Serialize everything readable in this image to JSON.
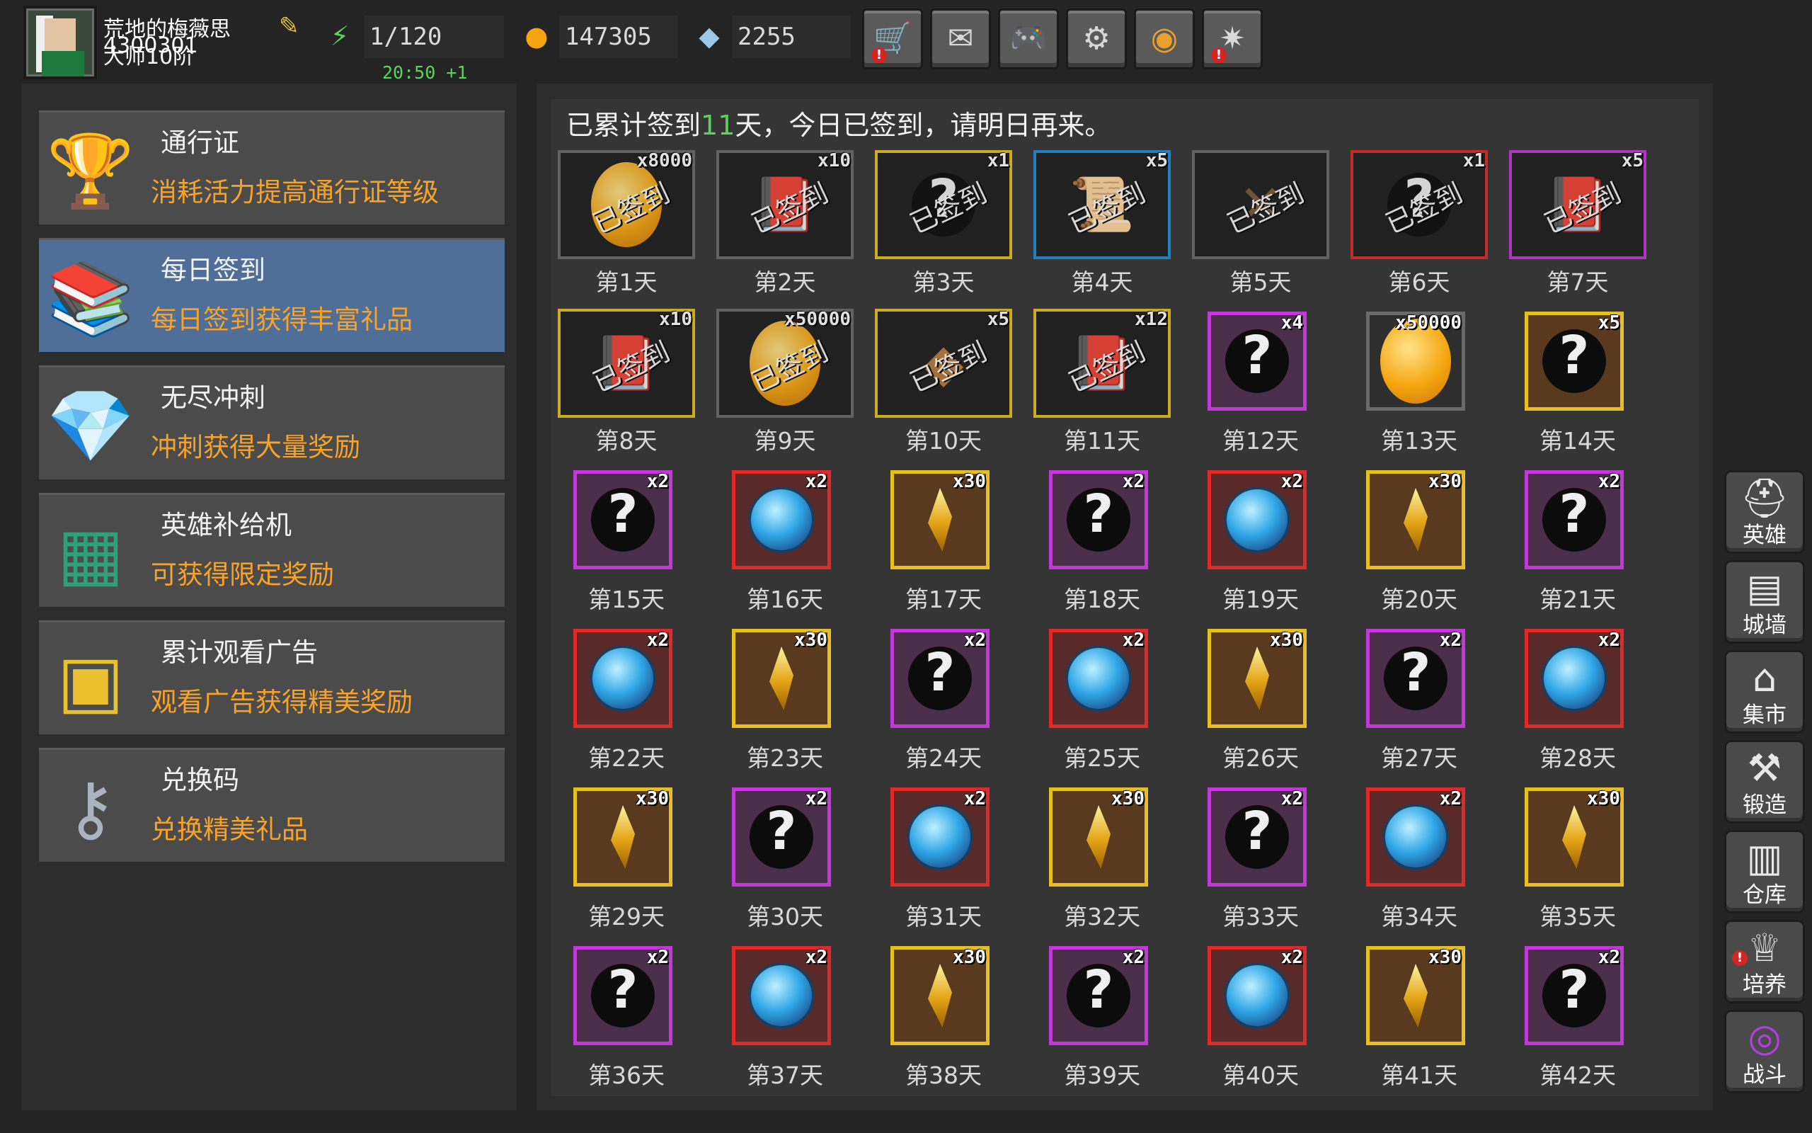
{
  "player": {
    "name": "荒地的梅薇思",
    "id": "4300301",
    "rank": "大师10阶",
    "icons": {
      "avatar": "mage-avatar",
      "edit": "edit-icon"
    }
  },
  "resources": {
    "energy": {
      "value": "1/120",
      "icon": "lightning-plus-icon"
    },
    "timer": "20:50 +1",
    "gold": {
      "value": "147305",
      "icon": "gold-coin-plus-icon"
    },
    "gems": {
      "value": "2255",
      "icon": "diamond-plus-icon"
    }
  },
  "top_buttons": [
    {
      "name": "shop-cart-icon",
      "alert": true
    },
    {
      "name": "mail-icon",
      "alert": false
    },
    {
      "name": "gamepad-icon",
      "alert": false
    },
    {
      "name": "gear-icon",
      "alert": false
    },
    {
      "name": "color-wheel-icon",
      "alert": false
    },
    {
      "name": "fireworks-icon",
      "alert": true
    }
  ],
  "menu": [
    {
      "title": "通行证",
      "desc": "消耗活力提高通行证等级",
      "icon": "golden-chalice-icon",
      "active": false
    },
    {
      "title": "每日签到",
      "desc": "每日签到获得丰富礼品",
      "icon": "book-stack-icon",
      "active": true
    },
    {
      "title": "无尽冲刺",
      "desc": "冲刺获得大量奖励",
      "icon": "crystal-trophy-icon",
      "active": false
    },
    {
      "title": "英雄补给机",
      "desc": "可获得限定奖励",
      "icon": "supply-machine-icon",
      "active": false
    },
    {
      "title": "累计观看广告",
      "desc": "观看广告获得精美奖励",
      "icon": "treasure-chest-icon",
      "active": false
    },
    {
      "title": "兑换码",
      "desc": "兑换精美礼品",
      "icon": "key-icon",
      "active": false
    }
  ],
  "signin": {
    "prefix": "已累计签到",
    "days": "11",
    "suffix": "天，今日已签到，请明日再来。",
    "claimed_label": "已签到"
  },
  "rewards": [
    {
      "day": "第1天",
      "qty": "x8000",
      "item": "coin",
      "rarity": "gray",
      "claimed": true
    },
    {
      "day": "第2天",
      "qty": "x10",
      "item": "book",
      "rarity": "gray",
      "claimed": true
    },
    {
      "day": "第3天",
      "qty": "x1",
      "item": "mystery",
      "rarity": "gold",
      "claimed": true
    },
    {
      "day": "第4天",
      "qty": "x5",
      "item": "scroll",
      "rarity": "blue",
      "claimed": true
    },
    {
      "day": "第5天",
      "qty": "",
      "item": "crossbow",
      "rarity": "gray",
      "claimed": true
    },
    {
      "day": "第6天",
      "qty": "x1",
      "item": "mystery",
      "rarity": "red",
      "claimed": true
    },
    {
      "day": "第7天",
      "qty": "x5",
      "item": "book",
      "rarity": "purple",
      "claimed": true
    },
    {
      "day": "第8天",
      "qty": "x10",
      "item": "book",
      "rarity": "gold",
      "claimed": true
    },
    {
      "day": "第9天",
      "qty": "x50000",
      "item": "coin",
      "rarity": "gray",
      "claimed": true
    },
    {
      "day": "第10天",
      "qty": "x5",
      "item": "ore",
      "rarity": "gold",
      "claimed": true
    },
    {
      "day": "第11天",
      "qty": "x12",
      "item": "book",
      "rarity": "gold",
      "claimed": true
    },
    {
      "day": "第12天",
      "qty": "x4",
      "item": "mystery",
      "rarity": "purple",
      "claimed": false
    },
    {
      "day": "第13天",
      "qty": "x50000",
      "item": "coin",
      "rarity": "gray",
      "claimed": false
    },
    {
      "day": "第14天",
      "qty": "x5",
      "item": "mystery",
      "rarity": "gold",
      "claimed": false
    },
    {
      "day": "第15天",
      "qty": "x2",
      "item": "mystery",
      "rarity": "purple",
      "claimed": false
    },
    {
      "day": "第16天",
      "qty": "x2",
      "item": "orb",
      "rarity": "red",
      "claimed": false
    },
    {
      "day": "第17天",
      "qty": "x30",
      "item": "crystal",
      "rarity": "gold",
      "claimed": false
    },
    {
      "day": "第18天",
      "qty": "x2",
      "item": "mystery",
      "rarity": "purple",
      "claimed": false
    },
    {
      "day": "第19天",
      "qty": "x2",
      "item": "orb",
      "rarity": "red",
      "claimed": false
    },
    {
      "day": "第20天",
      "qty": "x30",
      "item": "crystal",
      "rarity": "gold",
      "claimed": false
    },
    {
      "day": "第21天",
      "qty": "x2",
      "item": "mystery",
      "rarity": "purple",
      "claimed": false
    },
    {
      "day": "第22天",
      "qty": "x2",
      "item": "orb",
      "rarity": "red",
      "claimed": false
    },
    {
      "day": "第23天",
      "qty": "x30",
      "item": "crystal",
      "rarity": "gold",
      "claimed": false
    },
    {
      "day": "第24天",
      "qty": "x2",
      "item": "mystery",
      "rarity": "purple",
      "claimed": false
    },
    {
      "day": "第25天",
      "qty": "x2",
      "item": "orb",
      "rarity": "red",
      "claimed": false
    },
    {
      "day": "第26天",
      "qty": "x30",
      "item": "crystal",
      "rarity": "gold",
      "claimed": false
    },
    {
      "day": "第27天",
      "qty": "x2",
      "item": "mystery",
      "rarity": "purple",
      "claimed": false
    },
    {
      "day": "第28天",
      "qty": "x2",
      "item": "orb",
      "rarity": "red",
      "claimed": false
    },
    {
      "day": "第29天",
      "qty": "x30",
      "item": "crystal",
      "rarity": "gold",
      "claimed": false
    },
    {
      "day": "第30天",
      "qty": "x2",
      "item": "mystery",
      "rarity": "purple",
      "claimed": false
    },
    {
      "day": "第31天",
      "qty": "x2",
      "item": "orb",
      "rarity": "red",
      "claimed": false
    },
    {
      "day": "第32天",
      "qty": "x30",
      "item": "crystal",
      "rarity": "gold",
      "claimed": false
    },
    {
      "day": "第33天",
      "qty": "x2",
      "item": "mystery",
      "rarity": "purple",
      "claimed": false
    },
    {
      "day": "第34天",
      "qty": "x2",
      "item": "orb",
      "rarity": "red",
      "claimed": false
    },
    {
      "day": "第35天",
      "qty": "x30",
      "item": "crystal",
      "rarity": "gold",
      "claimed": false
    },
    {
      "day": "第36天",
      "qty": "x2",
      "item": "mystery",
      "rarity": "purple",
      "claimed": false
    },
    {
      "day": "第37天",
      "qty": "x2",
      "item": "orb",
      "rarity": "red",
      "claimed": false
    },
    {
      "day": "第38天",
      "qty": "x30",
      "item": "crystal",
      "rarity": "gold",
      "claimed": false
    },
    {
      "day": "第39天",
      "qty": "x2",
      "item": "mystery",
      "rarity": "purple",
      "claimed": false
    },
    {
      "day": "第40天",
      "qty": "x2",
      "item": "orb",
      "rarity": "red",
      "claimed": false
    },
    {
      "day": "第41天",
      "qty": "x30",
      "item": "crystal",
      "rarity": "gold",
      "claimed": false
    },
    {
      "day": "第42天",
      "qty": "x2",
      "item": "mystery",
      "rarity": "purple",
      "claimed": false
    }
  ],
  "side_nav": [
    {
      "label": "英雄",
      "icon": "helmet-icon",
      "alert": false
    },
    {
      "label": "城墙",
      "icon": "wall-icon",
      "alert": false
    },
    {
      "label": "集市",
      "icon": "market-stall-icon",
      "alert": false
    },
    {
      "label": "锻造",
      "icon": "anvil-icon",
      "alert": false
    },
    {
      "label": "仓库",
      "icon": "warehouse-icon",
      "alert": false
    },
    {
      "label": "培养",
      "icon": "chalice-icon",
      "alert": true
    },
    {
      "label": "战斗",
      "icon": "portal-icon",
      "alert": false
    }
  ],
  "colors": {
    "gray": "#6a6a6a",
    "gold": "#e8c01e",
    "blue": "#1e8fd8",
    "red": "#e02a2a",
    "purple": "#c238d8",
    "accent_orange": "#f7a229",
    "accent_green": "#5ad35a",
    "active_menu": "#4f6f99"
  }
}
